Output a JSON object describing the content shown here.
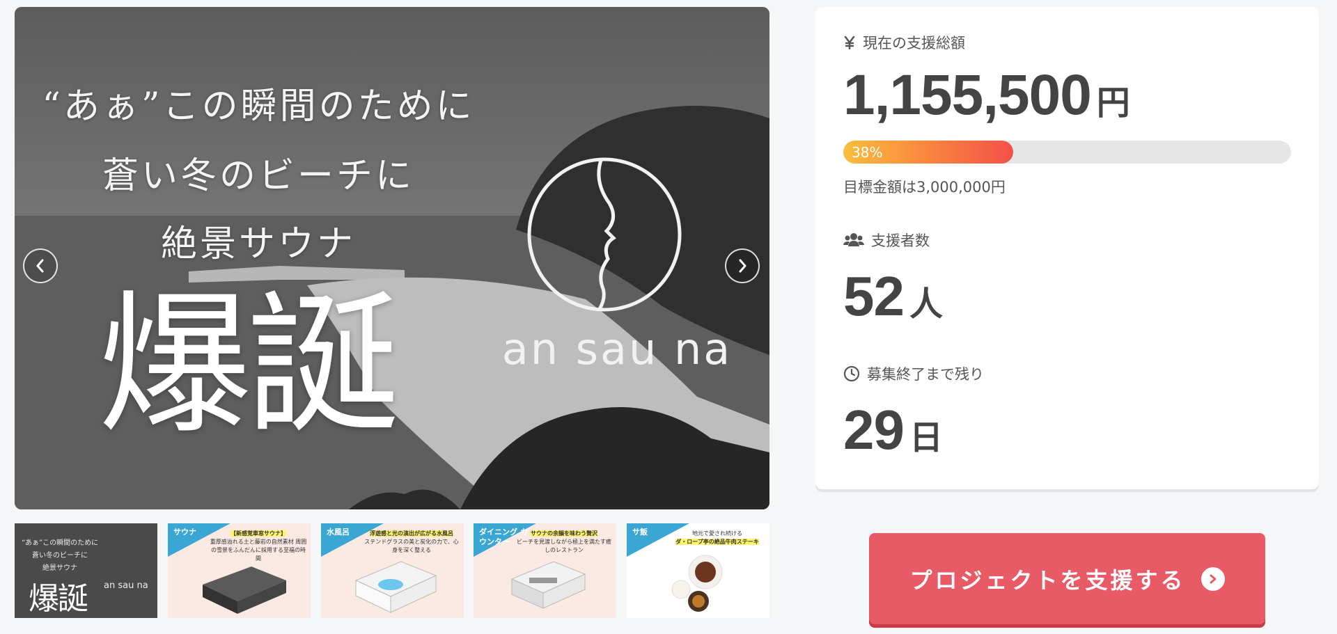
{
  "slider": {
    "catch_lines": [
      "“あぁ”この瞬間のために",
      "蒼い冬のビーチに",
      "絶景サウナ"
    ],
    "headline": "爆誕",
    "logo_text": "an sau na",
    "prev_icon": "chevron-left-icon",
    "next_icon": "chevron-right-icon"
  },
  "thumbnails": [
    {
      "lines": [
        "“あぁ”この瞬間のために",
        "蒼い冬のビーチに",
        "絶景サウナ"
      ],
      "headline": "爆誕",
      "logo": "an sau na"
    },
    {
      "tag": "サウナ",
      "caption_title": "【新感覚車窓サウナ】",
      "caption": "重厚感溢れる土と藤岩の自然素材 周囲の雪景をふんだんに採用する至福の時間"
    },
    {
      "tag": "水風呂",
      "caption_title": "浮遊感と光の演出が広がる水風呂",
      "caption": "ステンドグラスの美と炭化の力で、心身を深く整える"
    },
    {
      "tag": "ダイニング カウンター",
      "caption_title": "サウナの余韻を味わう贅沢",
      "caption": "ビーチを見渡しながら極上を満たす癒しのレストラン"
    },
    {
      "tag": "サ飯",
      "caption_title": "地元で愛され続ける",
      "caption": "ダ・ロープ亭の絶品牛肉ステーキ"
    }
  ],
  "stats": {
    "total": {
      "icon": "yen-icon",
      "label": "現在の支援総額",
      "value": "1,155,500",
      "unit": "円"
    },
    "progress": {
      "percent": 38,
      "label": "38%"
    },
    "goal": "目標金額は3,000,000円",
    "supporters": {
      "icon": "users-icon",
      "label": "支援者数",
      "value": "52",
      "unit": "人"
    },
    "remaining": {
      "icon": "clock-icon",
      "label": "募集終了まで残り",
      "value": "29",
      "unit": "日"
    }
  },
  "cta": {
    "label": "プロジェクトを支援する",
    "icon": "chevron-right-circle-icon"
  },
  "colors": {
    "cta": "#e85a66",
    "progress_start": "#f9be3c",
    "progress_end": "#f25149",
    "thumb_accent": "#3aa6d4"
  }
}
